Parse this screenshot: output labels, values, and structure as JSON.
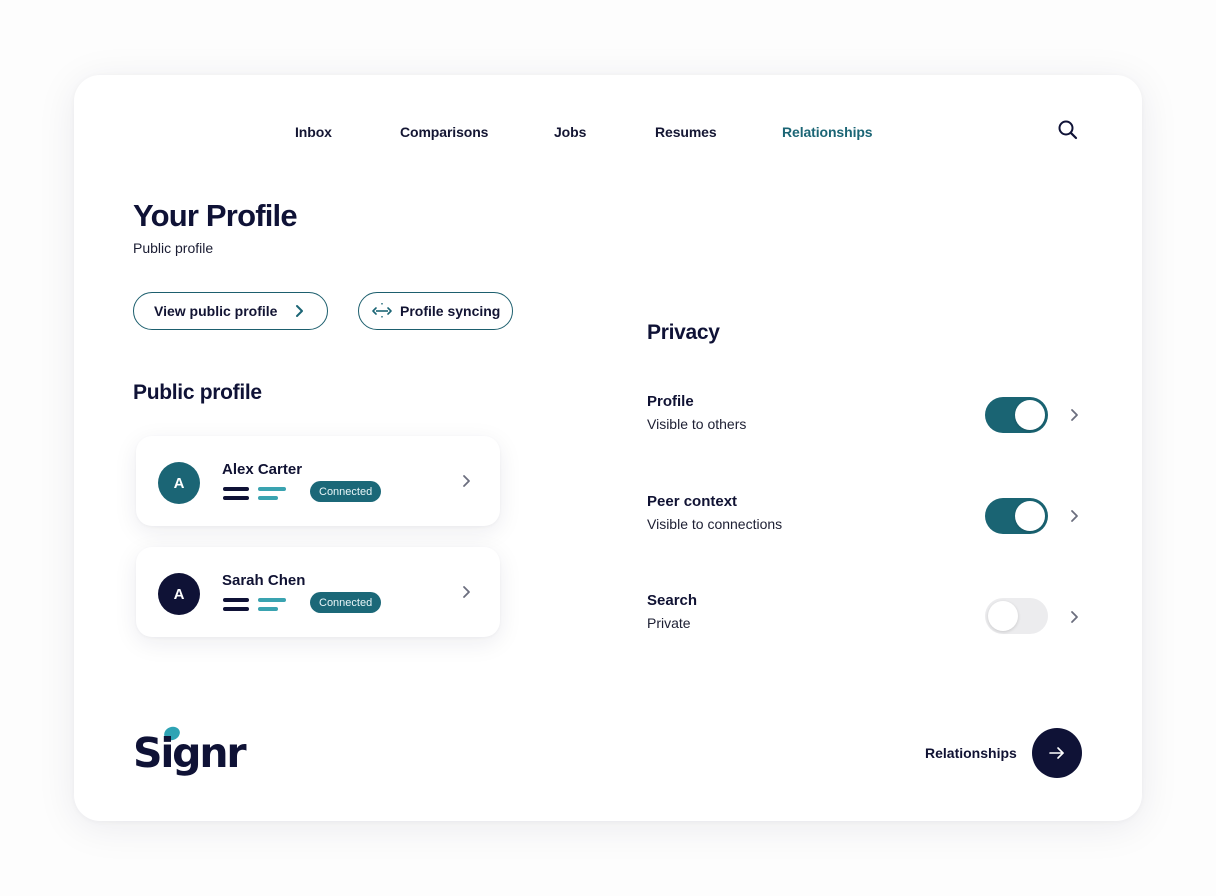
{
  "nav": {
    "items": [
      {
        "label": "Inbox",
        "active": false
      },
      {
        "label": "Comparisons",
        "active": false
      },
      {
        "label": "Jobs",
        "active": false
      },
      {
        "label": "Resumes",
        "active": false
      },
      {
        "label": "Relationships",
        "active": true
      }
    ],
    "search_icon": "search-icon"
  },
  "header": {
    "title": "Your Profile",
    "subtitle": "Public profile"
  },
  "actions": {
    "view_public_profile": "View public profile",
    "profile_syncing": "Profile syncing"
  },
  "public_profile": {
    "heading": "Public profile",
    "people": [
      {
        "initial": "A",
        "name": "Alex Carter",
        "status": "Connected",
        "avatar_color": "#1b6575"
      },
      {
        "initial": "A",
        "name": "Sarah Chen",
        "status": "Connected",
        "avatar_color": "#0f1236"
      }
    ]
  },
  "privacy": {
    "heading": "Privacy",
    "rows": [
      {
        "label": "Profile",
        "sub": "Visible to others",
        "enabled": true
      },
      {
        "label": "Peer context",
        "sub": "Visible to connections",
        "enabled": true
      },
      {
        "label": "Search",
        "sub": "Private",
        "enabled": false
      }
    ]
  },
  "footer": {
    "logo": "Signr",
    "link_label": "Relationships"
  },
  "colors": {
    "accent": "#1b6575",
    "navy": "#0f1236",
    "badge": "#1b6878",
    "toggle_off": "#ececee"
  }
}
